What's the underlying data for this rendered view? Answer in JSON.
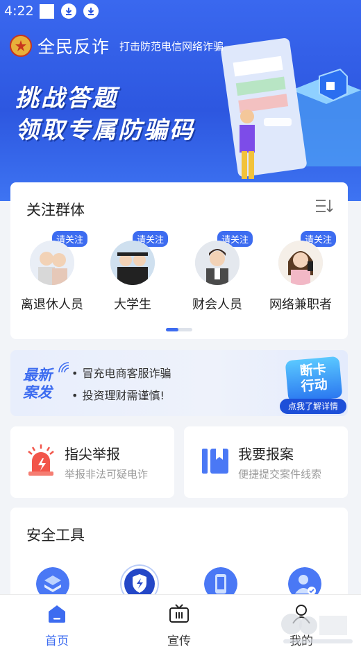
{
  "status_bar": {
    "time": "4:22"
  },
  "header": {
    "app_name": "全民反诈",
    "slogan": "打击防范电信网络诈骗"
  },
  "banner": {
    "headline_line1": "挑战答题",
    "headline_line2": "领取专属防骗码"
  },
  "groups": {
    "title": "关注群体",
    "follow_label": "请关注",
    "items": [
      {
        "label": "离退休人员"
      },
      {
        "label": "大学生"
      },
      {
        "label": "财会人员"
      },
      {
        "label": "网络兼职者"
      }
    ]
  },
  "news": {
    "tag_line1": "最新",
    "tag_line2": "案发",
    "items": [
      "冒充电商客服诈骗",
      "投资理财需谨慎!"
    ],
    "action_title_line1": "断卡",
    "action_title_line2": "行动",
    "action_cta": "点我了解详情"
  },
  "report": {
    "title": "指尖举报",
    "subtitle": "举报非法可疑电诈"
  },
  "case": {
    "title": "我要报案",
    "subtitle": "便捷提交案件线索"
  },
  "tools": {
    "title": "安全工具"
  },
  "bottom_nav": {
    "items": [
      {
        "label": "首页",
        "icon": "home-icon",
        "active": true
      },
      {
        "label": "宣传",
        "icon": "tv-icon",
        "active": false
      },
      {
        "label": "我的",
        "icon": "user-icon",
        "active": false
      }
    ]
  },
  "colors": {
    "accent": "#3d6cf0",
    "banner": "#2d57e0",
    "alert": "#f2554a"
  }
}
